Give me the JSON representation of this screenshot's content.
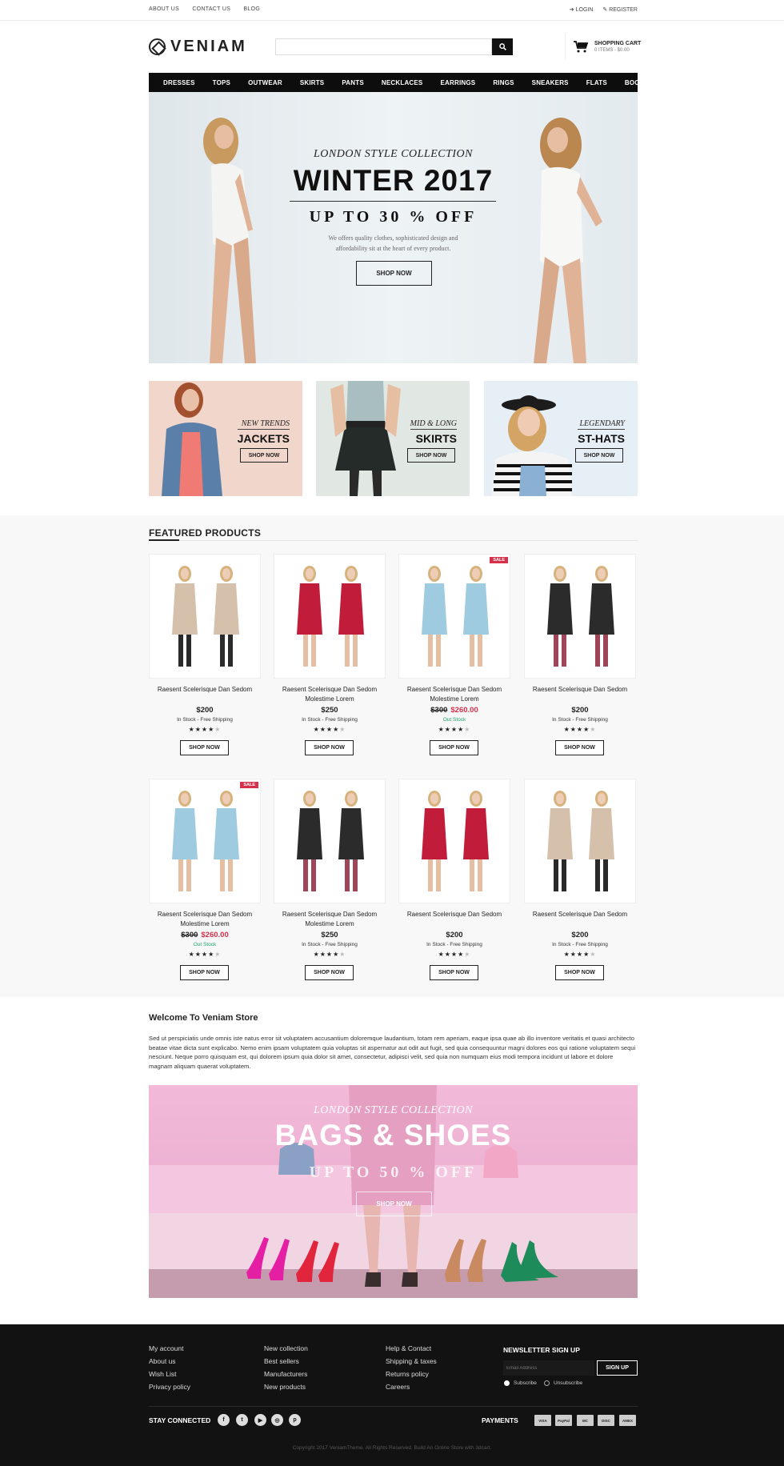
{
  "topbar": {
    "links": [
      "ABOUT US",
      "CONTACT US",
      "BLOG"
    ],
    "login": "LOGIN",
    "register": "REGISTER"
  },
  "header": {
    "logo": "VENIAM",
    "search_placeholder": "",
    "cart_title": "SHOPPING CART",
    "cart_summary": "0 ITEMS - $0.00"
  },
  "nav": [
    "DRESSES",
    "TOPS",
    "OUTWEAR",
    "SKIRTS",
    "PANTS",
    "NECKLACES",
    "EARRINGS",
    "RINGS",
    "SNEAKERS",
    "FLATS",
    "BOOTS"
  ],
  "hero": {
    "subtitle": "LONDON STYLE COLLECTION",
    "title": "WINTER 2017",
    "offer": "UP TO 30 % OFF",
    "description_1": "We offers quality clothes, sophisticated design and",
    "description_2": "affordability sit at the heart of every product.",
    "button": "SHOP NOW"
  },
  "promos": [
    {
      "tag": "NEW TRENDS",
      "title": "JACKETS",
      "button": "SHOP NOW"
    },
    {
      "tag": "MID & LONG",
      "title": "SKIRTS",
      "button": "SHOP NOW"
    },
    {
      "tag": "LEGENDARY",
      "title": "ST-HATS",
      "button": "SHOP NOW"
    }
  ],
  "featured": {
    "title": "FEATURED PRODUCTS",
    "products": [
      {
        "name": "Raesent Scelerisque Dan Sedom",
        "price": "$200",
        "old_price": "",
        "stock": "In Stock - Free Shipping",
        "out": false,
        "sale": "",
        "stars": "★★★★",
        "empty_stars": "★",
        "button": "SHOP NOW"
      },
      {
        "name": "Raesent Scelerisque Dan Sedom Molestime Lorem",
        "price": "$250",
        "old_price": "",
        "stock": "In Stock - Free Shipping",
        "out": false,
        "sale": "",
        "stars": "★★★★",
        "empty_stars": "★",
        "button": "SHOP NOW"
      },
      {
        "name": "Raesent Scelerisque Dan Sedom Molestime Lorem",
        "price": "$260.00",
        "old_price": "$300",
        "stock": "Out Stock",
        "out": true,
        "sale": "SALE",
        "stars": "★★★★",
        "empty_stars": "★",
        "button": "SHOP NOW"
      },
      {
        "name": "Raesent Scelerisque Dan Sedom",
        "price": "$200",
        "old_price": "",
        "stock": "In Stock - Free Shipping",
        "out": false,
        "sale": "",
        "stars": "★★★★",
        "empty_stars": "★",
        "button": "SHOP NOW"
      },
      {
        "name": "Raesent Scelerisque Dan Sedom Molestime Lorem",
        "price": "$260.00",
        "old_price": "$300",
        "stock": "Out Stock",
        "out": true,
        "sale": "SALE",
        "stars": "★★★★",
        "empty_stars": "★",
        "button": "SHOP NOW"
      },
      {
        "name": "Raesent Scelerisque Dan Sedom Molestime Lorem",
        "price": "$250",
        "old_price": "",
        "stock": "In Stock - Free Shipping",
        "out": false,
        "sale": "",
        "stars": "★★★★",
        "empty_stars": "★",
        "button": "SHOP NOW"
      },
      {
        "name": "Raesent Scelerisque Dan Sedom",
        "price": "$200",
        "old_price": "",
        "stock": "In Stock - Free Shipping",
        "out": false,
        "sale": "",
        "stars": "★★★★",
        "empty_stars": "★",
        "button": "SHOP NOW"
      },
      {
        "name": "Raesent Scelerisque Dan Sedom",
        "price": "$200",
        "old_price": "",
        "stock": "In Stock - Free Shipping",
        "out": false,
        "sale": "",
        "stars": "★★★★",
        "empty_stars": "★",
        "button": "SHOP NOW"
      }
    ]
  },
  "welcome": {
    "title": "Welcome To Veniam Store",
    "text": "Sed ut perspiciatis unde omnis iste natus error sit voluptatem accusantium doloremque laudantium, totam rem aperiam, eaque ipsa quae ab illo inventore veritatis et quasi architecto beatae vitae dicta sunt explicabo. Nemo enim ipsam voluptatem quia voluptas sit aspernatur aut odit aut fugit, sed quia consequuntur magni dolores eos qui ratione voluptatem sequi nesciunt. Neque porro quisquam est, qui dolorem ipsum quia dolor sit amet, consectetur, adipisci velit, sed quia non numquam eius modi tempora incidunt ut labore et dolore magnam aliquam quaerat voluptatem."
  },
  "banner2": {
    "subtitle": "LONDON STYLE COLLECTION",
    "title": "BAGS & SHOES",
    "offer": "UP TO 50 % OFF",
    "button": "SHOP NOW"
  },
  "footer": {
    "col1": [
      "My account",
      "About us",
      "Wish List",
      "Privacy policy"
    ],
    "col2": [
      "New collection",
      "Best sellers",
      "Manufacturers",
      "New products"
    ],
    "col3": [
      "Help & Contact",
      "Shipping & taxes",
      "Returns policy",
      "Careers"
    ],
    "newsletter_title": "NEWSLETTER SIGN UP",
    "email_placeholder": "Email Address",
    "signup": "SIGN UP",
    "subscribe": "Subscribe",
    "unsubscribe": "Unsubscribe",
    "stay_connected": "STAY CONNECTED",
    "social": [
      "f",
      "t",
      "▶",
      "◎",
      "p"
    ],
    "payments_title": "PAYMENTS",
    "payments": [
      "VISA",
      "PayPal",
      "MC",
      "DISC",
      "AMEX"
    ],
    "copyright": "Copyright 2017 VeniamTheme. All Rights Reserved. Build An Online Store with 3dcart."
  }
}
